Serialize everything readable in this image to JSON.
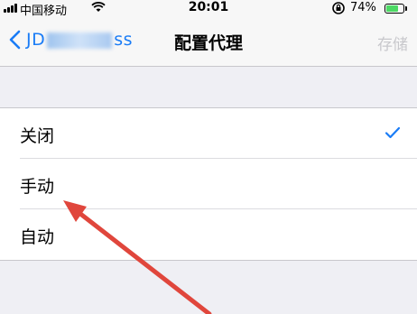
{
  "status_bar": {
    "carrier": "中国移动",
    "time": "20:01",
    "battery_percent": "74%",
    "battery_level": 0.74,
    "battery_color": "#4cd964"
  },
  "nav": {
    "back_label_start": "JD",
    "back_label_end": "ss",
    "title": "配置代理",
    "save_label": "存储"
  },
  "options": [
    {
      "label": "关闭",
      "selected": true
    },
    {
      "label": "手动",
      "selected": false
    },
    {
      "label": "自动",
      "selected": false
    }
  ],
  "colors": {
    "accent": "#1a7cf6",
    "annotation": "#e0463c"
  },
  "icons": [
    "signal-icon",
    "wifi-icon",
    "lock-rotation-icon",
    "battery-icon",
    "back-chevron-icon",
    "checkmark-icon"
  ]
}
